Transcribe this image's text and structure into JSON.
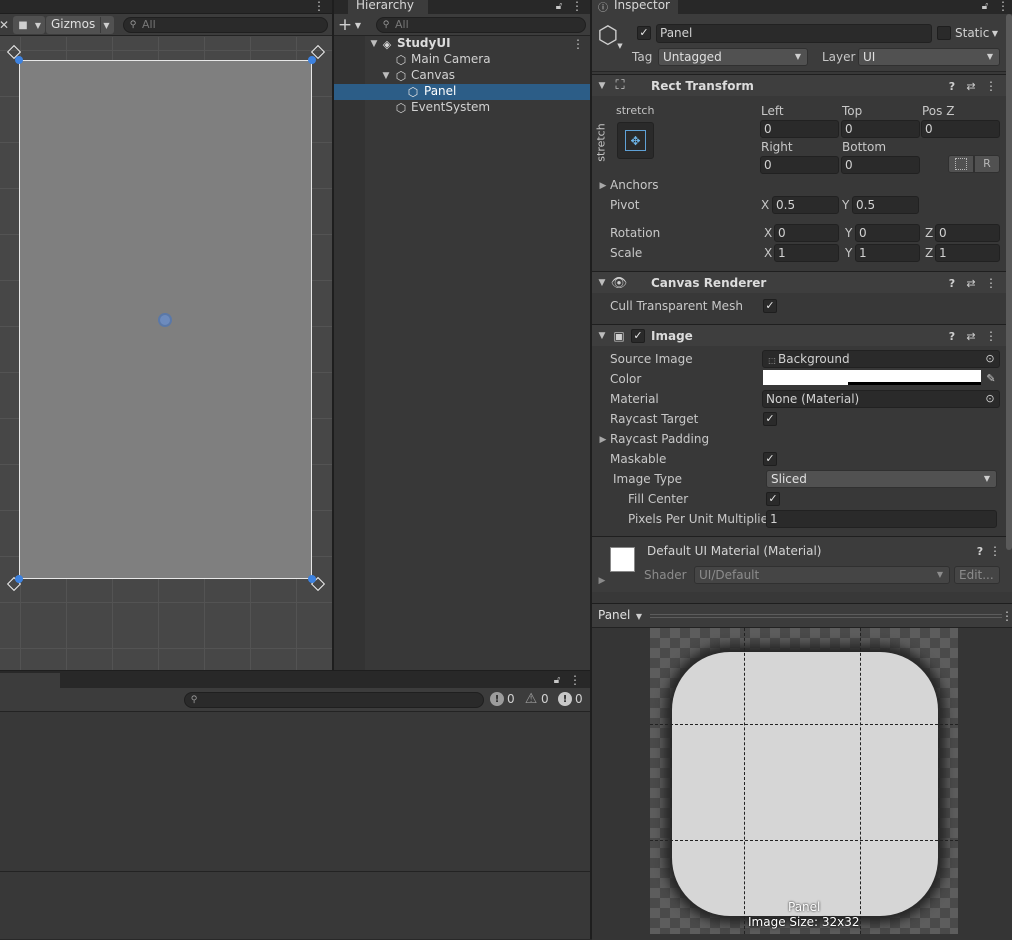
{
  "scene_view": {
    "gizmos_label": "Gizmos",
    "search_placeholder": "All"
  },
  "hierarchy": {
    "title": "Hierarchy",
    "search_placeholder": "All",
    "items": [
      {
        "label": "StudyUI"
      },
      {
        "label": "Main Camera"
      },
      {
        "label": "Canvas"
      },
      {
        "label": "Panel"
      },
      {
        "label": "EventSystem"
      }
    ]
  },
  "console": {
    "log_count": "0",
    "warning_count": "0",
    "error_count": "0"
  },
  "inspector": {
    "title": "Inspector",
    "object_name": "Panel",
    "static_label": "Static",
    "tag_label": "Tag",
    "tag_value": "Untagged",
    "layer_label": "Layer",
    "layer_value": "UI",
    "rect_transform": {
      "title": "Rect Transform",
      "anchor_preset_top": "stretch",
      "anchor_preset_side": "stretch",
      "left_label": "Left",
      "left": "0",
      "top_label": "Top",
      "top": "0",
      "posz_label": "Pos Z",
      "posz": "0",
      "right_label": "Right",
      "right": "0",
      "bottom_label": "Bottom",
      "bottom": "0",
      "r_button": "R",
      "anchors_label": "Anchors",
      "pivot_label": "Pivot",
      "pivot_x": "0.5",
      "pivot_y": "0.5",
      "rotation_label": "Rotation",
      "rot_x": "0",
      "rot_y": "0",
      "rot_z": "0",
      "scale_label": "Scale",
      "scale_x": "1",
      "scale_y": "1",
      "scale_z": "1",
      "x": "X",
      "y": "Y",
      "z": "Z"
    },
    "canvas_renderer": {
      "title": "Canvas Renderer",
      "cull_label": "Cull Transparent Mesh"
    },
    "image": {
      "title": "Image",
      "source_label": "Source Image",
      "source_value": "Background",
      "color_label": "Color",
      "material_label": "Material",
      "material_value": "None (Material)",
      "raycast_target_label": "Raycast Target",
      "raycast_padding_label": "Raycast Padding",
      "maskable_label": "Maskable",
      "image_type_label": "Image Type",
      "image_type_value": "Sliced",
      "fill_center_label": "Fill Center",
      "ppu_label": "Pixels Per Unit Multiplier",
      "ppu_value": "1"
    },
    "material": {
      "title": "Default UI Material (Material)",
      "shader_label": "Shader",
      "shader_value": "UI/Default",
      "edit_button": "Edit..."
    },
    "preview": {
      "dropdown": "Panel",
      "name": "Panel",
      "size": "Image Size: 32x32"
    }
  }
}
